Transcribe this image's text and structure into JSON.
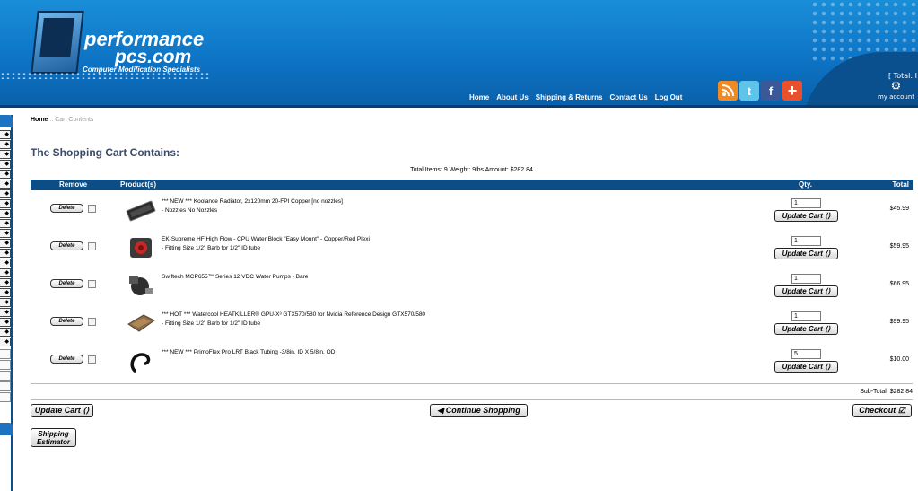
{
  "header": {
    "logo_line1": "performance",
    "logo_line2": "pcs.com",
    "logo_tagline": "Computer Modification Specialists",
    "nav": [
      "Home",
      "About Us",
      "Shipping & Returns",
      "Contact Us",
      "Log Out"
    ],
    "total_text": "[ Total: I",
    "account_label": "my account",
    "icons": [
      "rss-icon",
      "twitter-icon",
      "facebook-icon",
      "plus-icon"
    ]
  },
  "breadcrumb": {
    "home": "Home",
    "separator": " :: ",
    "current": "Cart Contents"
  },
  "page_title": "The Shopping Cart Contains:",
  "summary": "Total Items: 9  Weight: 9lbs  Amount: $282.84",
  "table": {
    "headers": {
      "remove": "Remove",
      "products": "Product(s)",
      "qty": "Qty.",
      "total": "Total"
    },
    "delete_label": "Delete",
    "update_label": "Update Cart",
    "rows": [
      {
        "name": "*** NEW *** Koolance Radiator, 2x120mm 20-FPI Copper [no nozzles]",
        "option": "- Nozzles No Nozzles",
        "qty": "1",
        "price": "$45.99"
      },
      {
        "name": "EK-Supreme HF High Flow - CPU Water Block \"Easy Mount\" - Copper/Red Plexi",
        "option": "- Fitting Size 1/2\" Barb for 1/2\" ID tube",
        "qty": "1",
        "price": "$59.95"
      },
      {
        "name": "Swiftech MCP655™ Series 12 VDC Water Pumps - Bare",
        "option": "",
        "qty": "1",
        "price": "$66.95"
      },
      {
        "name": "*** HOT *** Watercool HEATKILLER® GPU-X³ GTX570/580 for Nvidia Reference Design GTX570/580",
        "option": "- Fitting Size 1/2\" Barb for 1/2\" ID tube",
        "qty": "1",
        "price": "$99.95"
      },
      {
        "name": "*** NEW *** PrimoFlex Pro LRT Black Tubing -3/8in. ID X 5/8in. OD",
        "option": "",
        "qty": "5",
        "price": "$10.00"
      }
    ]
  },
  "subtotal": "Sub-Total: $282.84",
  "buttons": {
    "update_cart": "Update Cart",
    "continue_shopping": "Continue Shopping",
    "checkout": "Checkout",
    "shipping_estimator_line1": "Shipping",
    "shipping_estimator_line2": "Estimator"
  },
  "colors": {
    "header_blue": "#0d74c6",
    "table_header": "#0d4d86",
    "title": "#3a4a6a"
  }
}
